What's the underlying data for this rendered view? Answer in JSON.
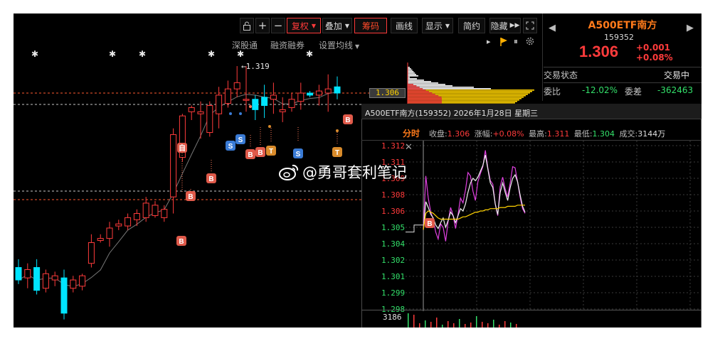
{
  "toolbar": {
    "fuquan": "复权",
    "diejia": "叠加",
    "chouma": "筹码",
    "huaxian": "画线",
    "xianshi": "显示",
    "jianyue": "简约",
    "yincang": "隐藏"
  },
  "subbar": {
    "shengutong": "深股通",
    "rongzi": "融资融券",
    "junxian": "设置均线"
  },
  "quote": {
    "name": "A500ETF南方",
    "code": "159352",
    "price": "1.306",
    "change": "+0.001",
    "change_pct": "+0.08%",
    "status_label": "交易状态",
    "status_value": "交易中",
    "weibi_label": "委比",
    "weibi_value": "-12.02%",
    "weicha_label": "委差",
    "weicha_value": "-362463"
  },
  "kline": {
    "high_label": "1.319",
    "price_tag": "1.306"
  },
  "popup": {
    "title": "A500ETF南方(159352) 2026年1月28日 星期三",
    "fenshi": "分时",
    "close_label": "收盘:",
    "close_value": "1.306",
    "chg_label": "涨幅:",
    "chg_value": "+0.08%",
    "high_label": "最高:",
    "high_value": "1.311",
    "low_label": "最低:",
    "low_value": "1.304",
    "vol_label": "成交:",
    "vol_value": "3144万",
    "vol_top": "3186",
    "y_ticks": [
      "1.312",
      "1.311",
      "1.309",
      "1.308",
      "1.306",
      "1.305",
      "1.304",
      "1.302",
      "1.301",
      "1.299",
      "1.298"
    ]
  },
  "watermark": "@勇哥套利笔记",
  "colors": {
    "up": "#ff3b3b",
    "down": "#00e5ff",
    "ma": "#ffd200",
    "accent": "#ff6a00",
    "badge_b": "#e05a4a",
    "badge_s": "#3a7bd5",
    "badge_t": "#d98b2b"
  },
  "chart_data": {
    "type": "candlestick",
    "series": [
      {
        "open": 1.222,
        "high": 1.226,
        "low": 1.214,
        "close": 1.216
      },
      {
        "open": 1.217,
        "high": 1.224,
        "low": 1.212,
        "close": 1.221
      },
      {
        "open": 1.222,
        "high": 1.226,
        "low": 1.209,
        "close": 1.211
      },
      {
        "open": 1.212,
        "high": 1.221,
        "low": 1.21,
        "close": 1.219
      },
      {
        "open": 1.216,
        "high": 1.22,
        "low": 1.213,
        "close": 1.218
      },
      {
        "open": 1.217,
        "high": 1.221,
        "low": 1.197,
        "close": 1.2
      },
      {
        "open": 1.212,
        "high": 1.218,
        "low": 1.21,
        "close": 1.216
      },
      {
        "open": 1.213,
        "high": 1.219,
        "low": 1.211,
        "close": 1.218
      },
      {
        "open": 1.224,
        "high": 1.238,
        "low": 1.222,
        "close": 1.234
      },
      {
        "open": 1.235,
        "high": 1.238,
        "low": 1.234,
        "close": 1.236
      },
      {
        "open": 1.236,
        "high": 1.244,
        "low": 1.232,
        "close": 1.241
      },
      {
        "open": 1.242,
        "high": 1.245,
        "low": 1.24,
        "close": 1.243
      },
      {
        "open": 1.242,
        "high": 1.248,
        "low": 1.24,
        "close": 1.246
      },
      {
        "open": 1.245,
        "high": 1.25,
        "low": 1.242,
        "close": 1.248
      },
      {
        "open": 1.246,
        "high": 1.256,
        "low": 1.244,
        "close": 1.253
      },
      {
        "open": 1.247,
        "high": 1.254,
        "low": 1.246,
        "close": 1.252
      },
      {
        "open": 1.246,
        "high": 1.252,
        "low": 1.244,
        "close": 1.25
      },
      {
        "open": 1.256,
        "high": 1.289,
        "low": 1.248,
        "close": 1.286
      },
      {
        "open": 1.275,
        "high": 1.296,
        "low": 1.273,
        "close": 1.295
      },
      {
        "open": 1.297,
        "high": 1.3,
        "low": 1.293,
        "close": 1.299
      },
      {
        "open": 1.296,
        "high": 1.302,
        "low": 1.284,
        "close": 1.297
      },
      {
        "open": 1.287,
        "high": 1.302,
        "low": 1.285,
        "close": 1.3
      },
      {
        "open": 1.296,
        "high": 1.309,
        "low": 1.289,
        "close": 1.305
      },
      {
        "open": 1.301,
        "high": 1.312,
        "low": 1.299,
        "close": 1.308
      },
      {
        "open": 1.308,
        "high": 1.319,
        "low": 1.304,
        "close": 1.311
      },
      {
        "open": 1.303,
        "high": 1.319,
        "low": 1.297,
        "close": 1.303
      },
      {
        "open": 1.303,
        "high": 1.305,
        "low": 1.293,
        "close": 1.298
      },
      {
        "open": 1.304,
        "high": 1.31,
        "low": 1.294,
        "close": 1.3
      },
      {
        "open": 1.303,
        "high": 1.311,
        "low": 1.296,
        "close": 1.305
      },
      {
        "open": 1.297,
        "high": 1.304,
        "low": 1.292,
        "close": 1.298
      },
      {
        "open": 1.299,
        "high": 1.306,
        "low": 1.297,
        "close": 1.303
      },
      {
        "open": 1.302,
        "high": 1.311,
        "low": 1.298,
        "close": 1.306
      },
      {
        "open": 1.306,
        "high": 1.307,
        "low": 1.304,
        "close": 1.305
      },
      {
        "open": 1.305,
        "high": 1.31,
        "low": 1.3,
        "close": 1.307
      },
      {
        "open": 1.306,
        "high": 1.315,
        "low": 1.297,
        "close": 1.308
      },
      {
        "open": 1.309,
        "high": 1.314,
        "low": 1.303,
        "close": 1.306
      }
    ],
    "intraday": {
      "y_range": [
        1.298,
        1.312
      ],
      "price": [
        1.3048,
        1.3072,
        1.3067,
        1.3061,
        1.3058,
        1.3052,
        1.3049,
        1.3054,
        1.3058,
        1.305,
        1.3056,
        1.3063,
        1.306,
        1.3054,
        1.306,
        1.3066,
        1.3064,
        1.307,
        1.308,
        1.3088,
        1.3092,
        1.309,
        1.3093,
        1.3098,
        1.3103,
        1.3112,
        1.31,
        1.3088,
        1.3084,
        1.307,
        1.3061,
        1.308,
        1.3088,
        1.308,
        1.3073,
        1.3084,
        1.3092,
        1.3095,
        1.3089,
        1.3078,
        1.3068,
        1.3063
      ],
      "line2": [
        1.3048,
        1.3094,
        1.3075,
        1.3063,
        1.3057,
        1.3046,
        1.304,
        1.3053,
        1.305,
        1.3038,
        1.3055,
        1.3067,
        1.306,
        1.3049,
        1.3061,
        1.3075,
        1.3071,
        1.3082,
        1.3097,
        1.3094,
        1.3081,
        1.3073,
        1.3089,
        1.3096,
        1.3102,
        1.3116,
        1.3101,
        1.309,
        1.3087,
        1.307,
        1.306,
        1.3085,
        1.3093,
        1.3083,
        1.3076,
        1.3088,
        1.3102,
        1.3101,
        1.3089,
        1.3076,
        1.3066,
        1.3062
      ],
      "avg": [
        1.3048,
        1.3062,
        1.3064,
        1.3063,
        1.3062,
        1.306,
        1.3058,
        1.3057,
        1.3057,
        1.3057,
        1.3057,
        1.3057,
        1.3057,
        1.3057,
        1.3057,
        1.3058,
        1.3059,
        1.3059,
        1.306,
        1.3061,
        1.3062,
        1.3063,
        1.3063,
        1.3064,
        1.3064,
        1.3065,
        1.3065,
        1.3066,
        1.3066,
        1.3066,
        1.3066,
        1.3067,
        1.3067,
        1.3067,
        1.3068,
        1.3068,
        1.3068,
        1.3068,
        1.3069,
        1.3069,
        1.3069,
        1.3069
      ]
    }
  }
}
